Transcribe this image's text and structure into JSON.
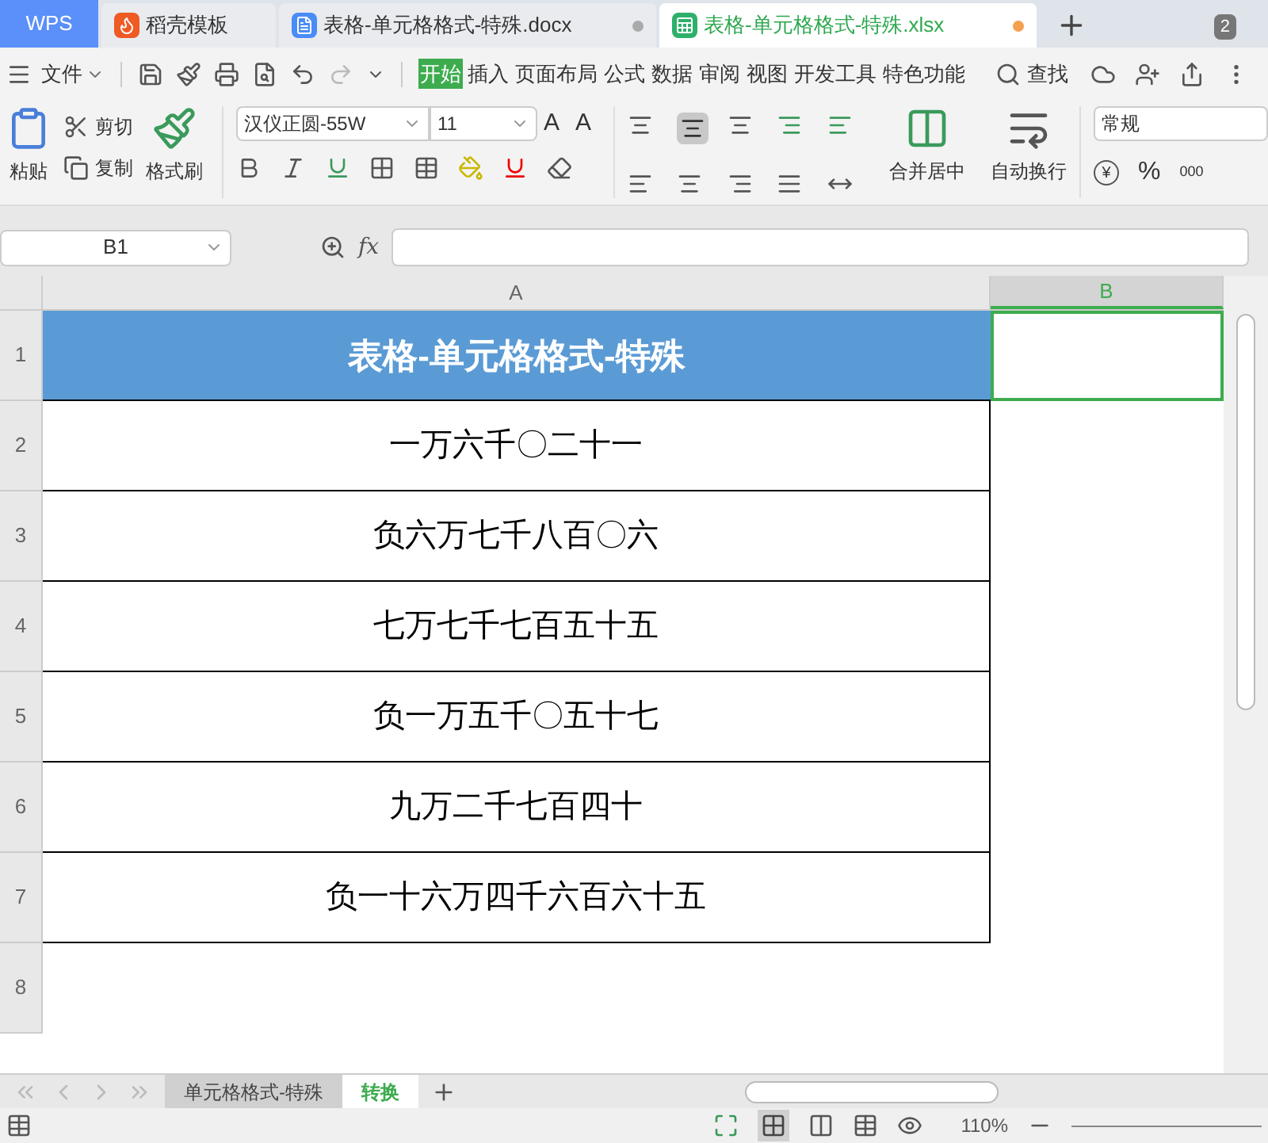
{
  "app_tab": "WPS",
  "doc_tabs": [
    {
      "title": "稻壳模板",
      "kind": "template",
      "selected": false,
      "modified": false
    },
    {
      "title": "表格-单元格格式-特殊.docx",
      "kind": "writer",
      "selected": false,
      "modified": true
    },
    {
      "title": "表格-单元格格式-特殊.xlsx",
      "kind": "sheet",
      "selected": true,
      "modified": true
    }
  ],
  "window_count": "2",
  "menu": {
    "file": "文件",
    "tabs": [
      {
        "label": "开始",
        "selected": true
      },
      {
        "label": "插入",
        "selected": false
      },
      {
        "label": "页面布局",
        "selected": false
      },
      {
        "label": "公式",
        "selected": false
      },
      {
        "label": "数据",
        "selected": false
      },
      {
        "label": "审阅",
        "selected": false
      },
      {
        "label": "视图",
        "selected": false
      },
      {
        "label": "开发工具",
        "selected": false
      },
      {
        "label": "特色功能",
        "selected": false
      }
    ],
    "search": "查找"
  },
  "ribbon": {
    "paste": "粘贴",
    "cut": "剪切",
    "copy": "复制",
    "format_painter": "格式刷",
    "font_name": "汉仪正圆-55W",
    "font_size": "11",
    "merge": "合并居中",
    "wrap": "自动换行",
    "number_format": "常规",
    "grow_font": "A",
    "shrink_font": "A",
    "currency": "¥",
    "percent": "%",
    "thousands": "000"
  },
  "formula_bar": {
    "name_box": "B1",
    "fx": "fx"
  },
  "columns": [
    {
      "label": "A",
      "selected": false
    },
    {
      "label": "B",
      "selected": true
    }
  ],
  "rows": [
    {
      "number": "1",
      "text": "表格-单元格格式-特殊",
      "kind": "header"
    },
    {
      "number": "2",
      "text": "一万六千〇二十一",
      "kind": "data"
    },
    {
      "number": "3",
      "text": "负六万七千八百〇六",
      "kind": "data"
    },
    {
      "number": "4",
      "text": "七万七千七百五十五",
      "kind": "data"
    },
    {
      "number": "5",
      "text": "负一万五千〇五十七",
      "kind": "data"
    },
    {
      "number": "6",
      "text": "九万二千七百四十",
      "kind": "data"
    },
    {
      "number": "7",
      "text": "负一十六万四千六百六十五",
      "kind": "data"
    },
    {
      "number": "8",
      "kind": "empty"
    }
  ],
  "sheets": [
    {
      "name": "单元格格式-特殊",
      "selected": false
    },
    {
      "name": "转换",
      "selected": true
    }
  ],
  "status_bar": {
    "zoom": "110%"
  }
}
